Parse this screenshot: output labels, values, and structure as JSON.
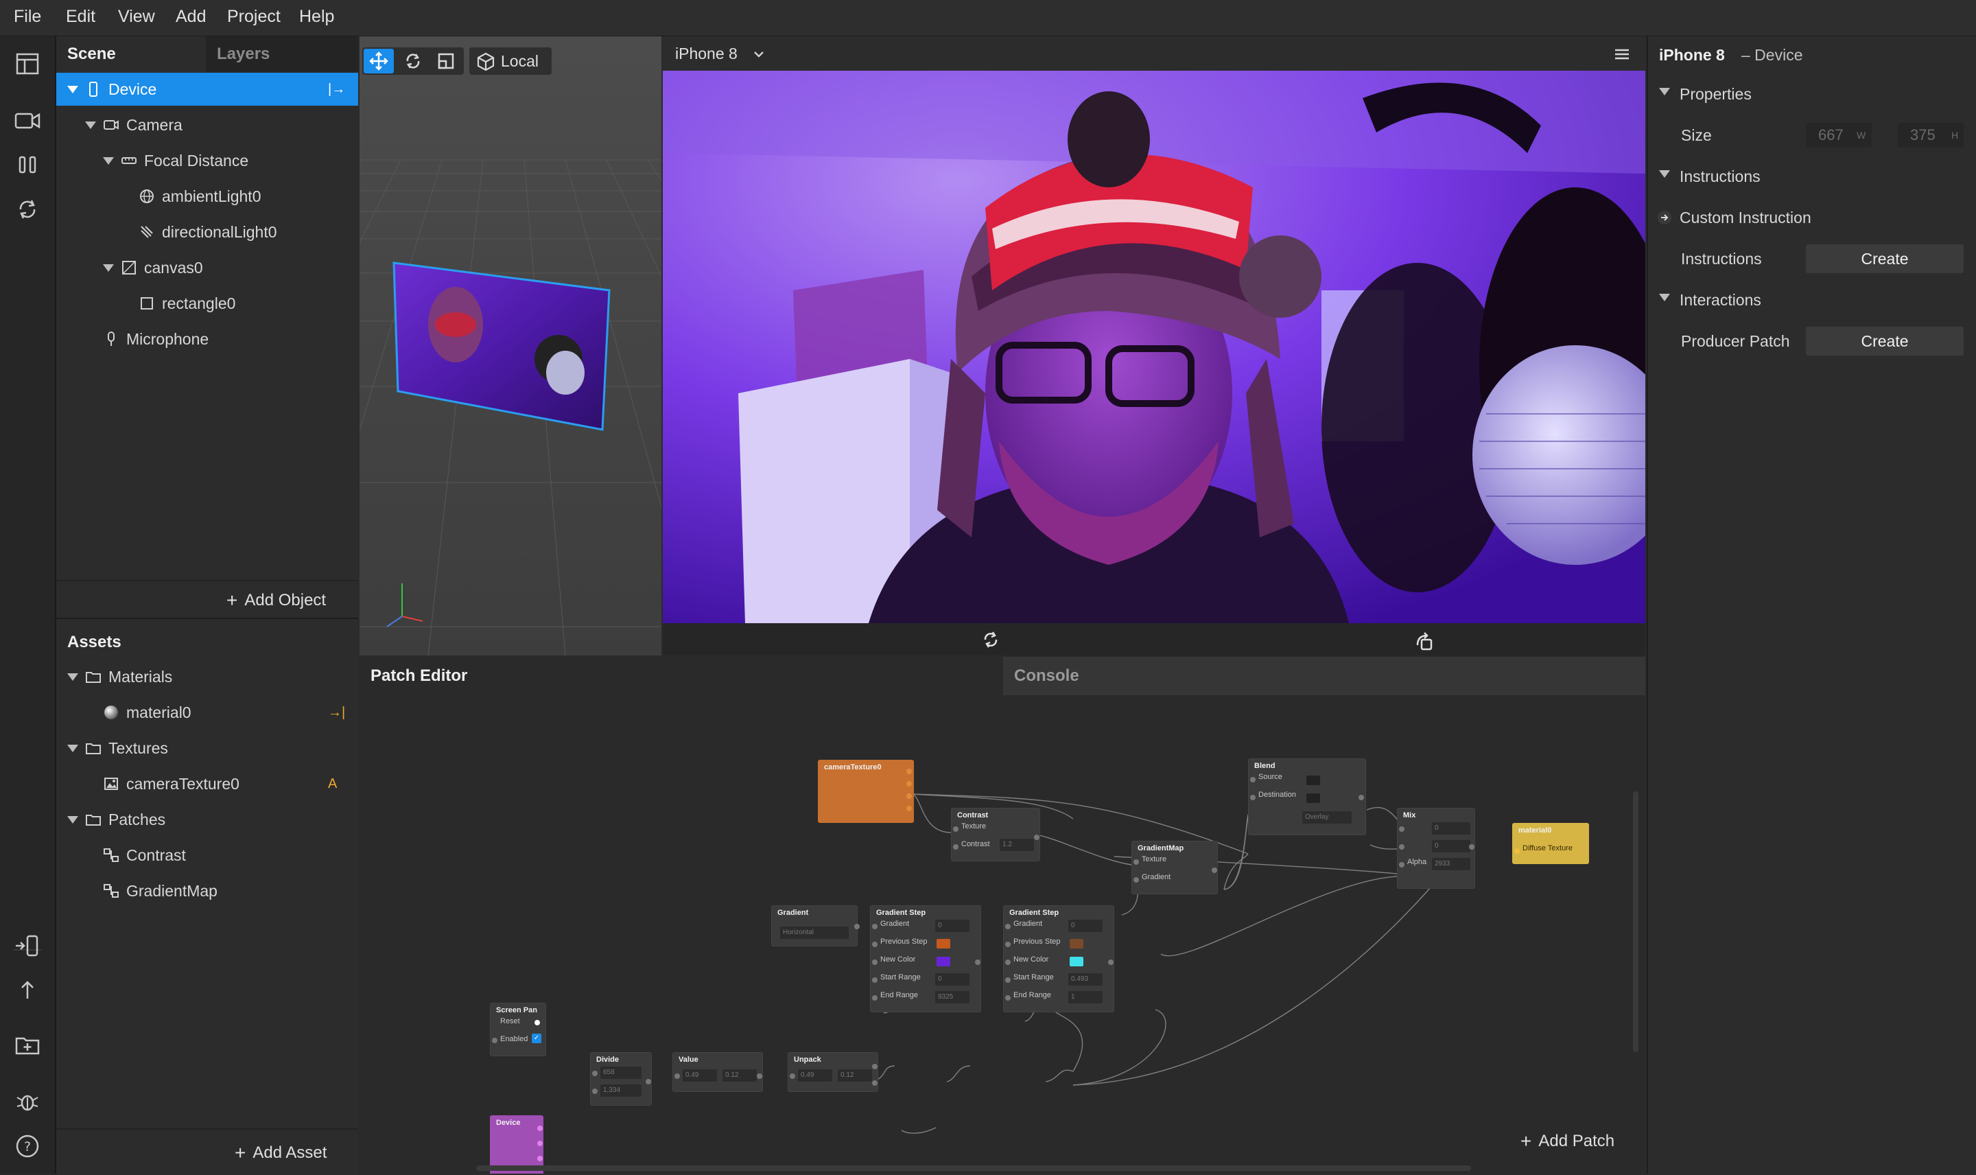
{
  "menubar": {
    "items": [
      "File",
      "Edit",
      "View",
      "Add",
      "Project",
      "Help"
    ]
  },
  "scene": {
    "tabs": [
      "Scene",
      "Layers"
    ],
    "tree": [
      {
        "label": "Device",
        "icon": "device-icon",
        "indent": 0,
        "expanded": true
      },
      {
        "label": "Camera",
        "icon": "camera-icon",
        "indent": 1,
        "expanded": true
      },
      {
        "label": "Focal Distance",
        "icon": "focal-distance-icon",
        "indent": 2,
        "expanded": true
      },
      {
        "label": "ambientLight0",
        "icon": "ambient-light-icon",
        "indent": 3
      },
      {
        "label": "directionalLight0",
        "icon": "directional-light-icon",
        "indent": 3
      },
      {
        "label": "canvas0",
        "icon": "canvas-icon",
        "indent": 2,
        "expanded": true
      },
      {
        "label": "rectangle0",
        "icon": "rectangle-icon",
        "indent": 3
      },
      {
        "label": "Microphone",
        "icon": "microphone-icon",
        "indent": 1
      }
    ],
    "add_object": "Add Object"
  },
  "assets": {
    "title": "Assets",
    "tree": [
      {
        "label": "Materials",
        "icon": "folder-icon",
        "indent": 0,
        "expanded": true
      },
      {
        "label": "material0",
        "icon": "material-sphere-icon",
        "indent": 1,
        "badge": "→|"
      },
      {
        "label": "Textures",
        "icon": "folder-icon",
        "indent": 0,
        "expanded": true
      },
      {
        "label": "cameraTexture0",
        "icon": "image-icon",
        "indent": 1,
        "badge": "A"
      },
      {
        "label": "Patches",
        "icon": "folder-icon",
        "indent": 0,
        "expanded": true
      },
      {
        "label": "Contrast",
        "icon": "patch-icon",
        "indent": 1
      },
      {
        "label": "GradientMap",
        "icon": "patch-icon",
        "indent": 1
      }
    ],
    "add_asset": "Add Asset"
  },
  "viewport": {
    "space_label": "Local"
  },
  "simulator": {
    "device": "iPhone 8"
  },
  "inspector": {
    "title": "iPhone 8",
    "subtitle": "– Device",
    "sections": {
      "properties": "Properties",
      "instructions": "Instructions",
      "interactions": "Interactions"
    },
    "size_label": "Size",
    "size_w": "667",
    "size_w_unit": "W",
    "size_h": "375",
    "size_h_unit": "H",
    "custom_instruction": "Custom Instruction",
    "instructions_label": "Instructions",
    "producer_patch_label": "Producer Patch",
    "create": "Create"
  },
  "patch_editor": {
    "tabs": [
      "Patch Editor",
      "Console"
    ],
    "add_patch": "Add Patch",
    "nodes": {
      "camera_texture": "cameraTexture0",
      "contrast": {
        "title": "Contrast",
        "texture": "Texture",
        "contrast": "Contrast",
        "contrast_value": "1.2"
      },
      "blend": {
        "title": "Blend",
        "source": "Source",
        "destination": "Destination",
        "mode": "Overlay"
      },
      "gradient_map": {
        "title": "GradientMap",
        "texture": "Texture",
        "gradient": "Gradient"
      },
      "mix": {
        "title": "Mix",
        "v1": "0",
        "v2": "0",
        "alpha": "Alpha",
        "alpha_value": "2933"
      },
      "material": {
        "title": "material0",
        "port": "Diffuse Texture"
      },
      "gradient": {
        "title": "Gradient",
        "mode": "Horizontal"
      },
      "gradient_step_1": {
        "title": "Gradient Step",
        "gradient": "Gradient",
        "gradient_value": "0",
        "previous": "Previous Step",
        "new_color": "New Color",
        "start": "Start Range",
        "start_value": "0",
        "end": "End Range",
        "end_value": "9325"
      },
      "gradient_step_2": {
        "title": "Gradient Step",
        "gradient": "Gradient",
        "gradient_value": "0",
        "previous": "Previous Step",
        "new_color": "New Color",
        "start": "Start Range",
        "start_value": "0.493",
        "end": "End Range",
        "end_value": "1"
      },
      "screen_pan": {
        "title": "Screen Pan",
        "reset": "Reset",
        "enabled": "Enabled"
      },
      "divide": {
        "title": "Divide",
        "v1": "658",
        "v2": "1,334"
      },
      "value": {
        "title": "Value",
        "v1": "0.49",
        "v2": "0.12"
      },
      "unpack": {
        "title": "Unpack",
        "v1": "0.49",
        "v2": "0.12"
      },
      "device": {
        "title": "Device"
      }
    }
  },
  "colors": {
    "accent": "#1b8dea",
    "camera_texture_node": "#c8702f",
    "material_node": "#d6b545",
    "device_node": "#a04fb4",
    "step1_color": "#c65a1c",
    "step1_new_color": "#6a24d8",
    "step2_color": "#7a4a2a",
    "step2_new_color": "#3fe0ea"
  }
}
